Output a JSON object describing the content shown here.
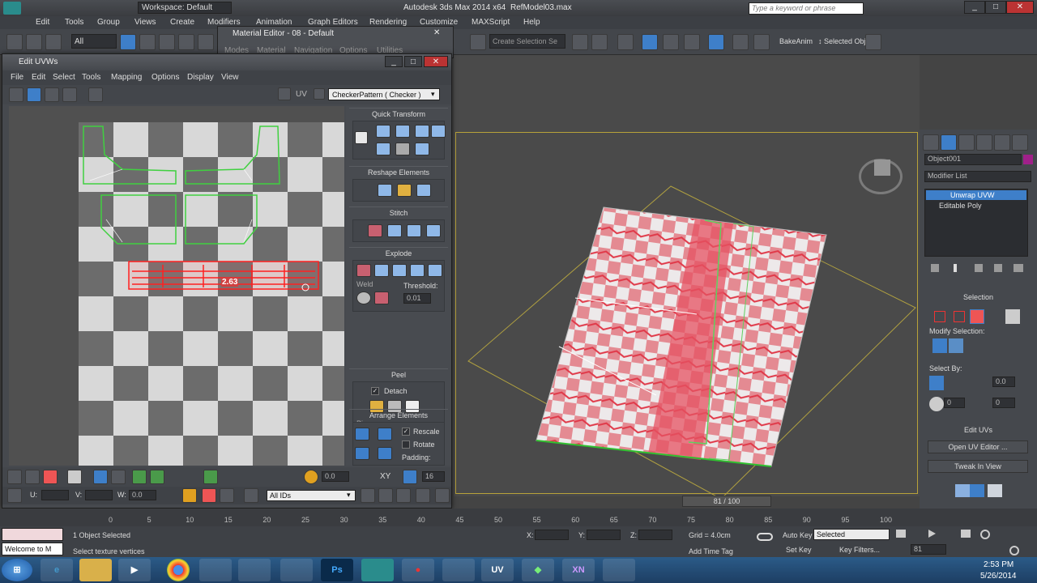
{
  "app": {
    "title": "Autodesk 3ds Max 2014 x64",
    "file": "RefModel03.max",
    "workspace": "Workspace: Default",
    "search_placeholder": "Type a keyword or phrase"
  },
  "main_menu": [
    "Edit",
    "Tools",
    "Group",
    "Views",
    "Create",
    "Modifiers",
    "Animation",
    "Graph Editors",
    "Rendering",
    "Customize",
    "MAXScript",
    "Help"
  ],
  "main_toolbar": {
    "filter": "All",
    "selection_set_placeholder": "Create Selection Se",
    "bake_anim": "BakeAnim",
    "selected_obj": "↕ Selected Obj"
  },
  "material_editor": {
    "title": "Material Editor - 08 - Default",
    "menu": [
      "Modes",
      "Material",
      "Navigation",
      "Options",
      "Utilities"
    ]
  },
  "uv_editor": {
    "title": "Edit UVWs",
    "menu": [
      "File",
      "Edit",
      "Select",
      "Tools",
      "Mapping",
      "Options",
      "Display",
      "View"
    ],
    "uv_label": "UV",
    "map_select": "CheckerPattern  ( Checker )",
    "dimension_label": "2.63",
    "panels": {
      "quick_transform": "Quick Transform",
      "reshape": "Reshape Elements",
      "stitch": "Stitch",
      "explode": "Explode",
      "weld": "Weld",
      "threshold_label": "Threshold:",
      "threshold_value": "0.01",
      "peel": "Peel",
      "detach": "Detach",
      "pins": "Pins:",
      "arrange": "Arrange Elements",
      "rescale": "Rescale",
      "rotate": "Rotate",
      "padding": "Padding:"
    },
    "bottom": {
      "u_label": "U:",
      "v_label": "V:",
      "w_label": "W:",
      "w_value": "0.0",
      "all_ids": "All IDs",
      "zero_value": "0.0",
      "xy_label": "XY",
      "grid_value": "16"
    }
  },
  "command_panel": {
    "object_name": "Object001",
    "object_color": "#a0208a",
    "modifier_list": "Modifier List",
    "stack": [
      "Unwrap UVW",
      "Editable Poly"
    ],
    "selection_title": "Selection",
    "modify_selection": "Modify Selection:",
    "select_by": "Select By:",
    "select_by_value1": "0.0",
    "select_by_value2": "0",
    "select_by_value3": "0",
    "edit_uvs_title": "Edit UVs",
    "open_uv_editor": "Open UV Editor ...",
    "tweak_in_view": "Tweak In View"
  },
  "timeline": {
    "frame": "81 / 100",
    "ticks": [
      "0",
      "5",
      "10",
      "15",
      "20",
      "25",
      "30",
      "35",
      "40",
      "45",
      "50",
      "55",
      "60",
      "65",
      "70",
      "75",
      "80",
      "85",
      "90",
      "95",
      "100"
    ]
  },
  "status": {
    "welcome": "Welcome to M",
    "selected": "1 Object Selected",
    "prompt": "Select texture vertices",
    "x_label": "X:",
    "y_label": "Y:",
    "z_label": "Z:",
    "grid": "Grid = 4.0cm",
    "add_time_tag": "Add Time Tag",
    "auto_key": "Auto Key",
    "set_key": "Set Key",
    "key_mode": "Selected",
    "key_filters": "Key Filters...",
    "current_frame": "81"
  },
  "taskbar": {
    "time": "2:53 PM",
    "date": "5/26/2014",
    "apps": [
      "start",
      "ie",
      "explorer",
      "media",
      "chrome",
      "notepad",
      "folder",
      "max-tool",
      "photoshop",
      "3dsmax",
      "fruit-app",
      "pen-app",
      "uv-app",
      "green-app",
      "xn-app",
      "misc-app"
    ]
  },
  "colors": {
    "accent_blue": "#3e7fc9",
    "uv_selection": "#ff2020",
    "uv_shells": "#40d040",
    "viewport_frame": "#b8a23a"
  }
}
